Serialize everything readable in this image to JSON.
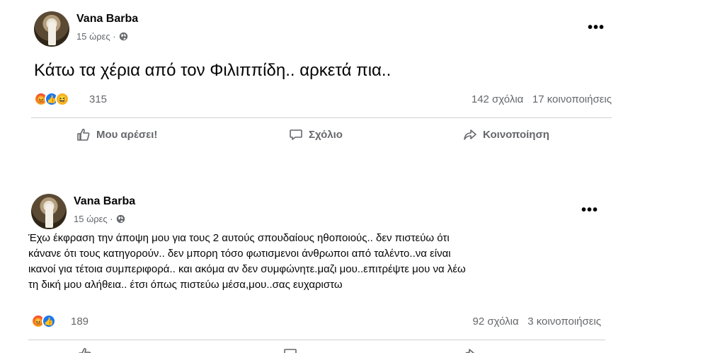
{
  "posts": [
    {
      "author": "Vana Barba",
      "time": "15 ώρες ·",
      "text": "Κάτω τα χέρια από τον Φιλιππίδη.. αρκετά πια..",
      "reaction_count": "315",
      "comments": "142 σχόλια",
      "shares": "17 κοινοποιήσεις",
      "actions": {
        "like": "Μου αρέσει!",
        "comment": "Σχόλιο",
        "share": "Κοινοποίηση"
      }
    },
    {
      "author": "Vana Barba",
      "time": "15 ώρες ·",
      "text": "Έχω έκφραση την άποψη μου για τους 2 αυτούς σπουδαίους ηθοποιούς.. δεν πιστεύω  ότι\nκάνανε ότι τους κατηγορούν.. δεν μπορη τόσο φωτισμενοι άνθρωποι από ταλέντο..να είναι\nικανοί για τέτοια συμπεριφορά.. και ακόμα αν δεν συμφώνητε.μαζι μου..επιτρέψτε μου να λέω\nτη  δική μου αλήθεια.. έτσι όπως πιστεύω μέσα,μου..σας ευχαριστω",
      "reaction_count": "189",
      "comments": "92 σχόλια",
      "shares": "3 κοινοποιήσεις"
    }
  ],
  "icons": {
    "privacy": "globe-icon",
    "menu": "more-options-icon",
    "like": "thumbs-up-icon",
    "comment": "comment-bubble-icon",
    "share": "share-arrow-icon"
  },
  "colors": {
    "like_blue": "#1877f2",
    "secondary_text": "#65676b",
    "divider": "#ced0d4"
  }
}
